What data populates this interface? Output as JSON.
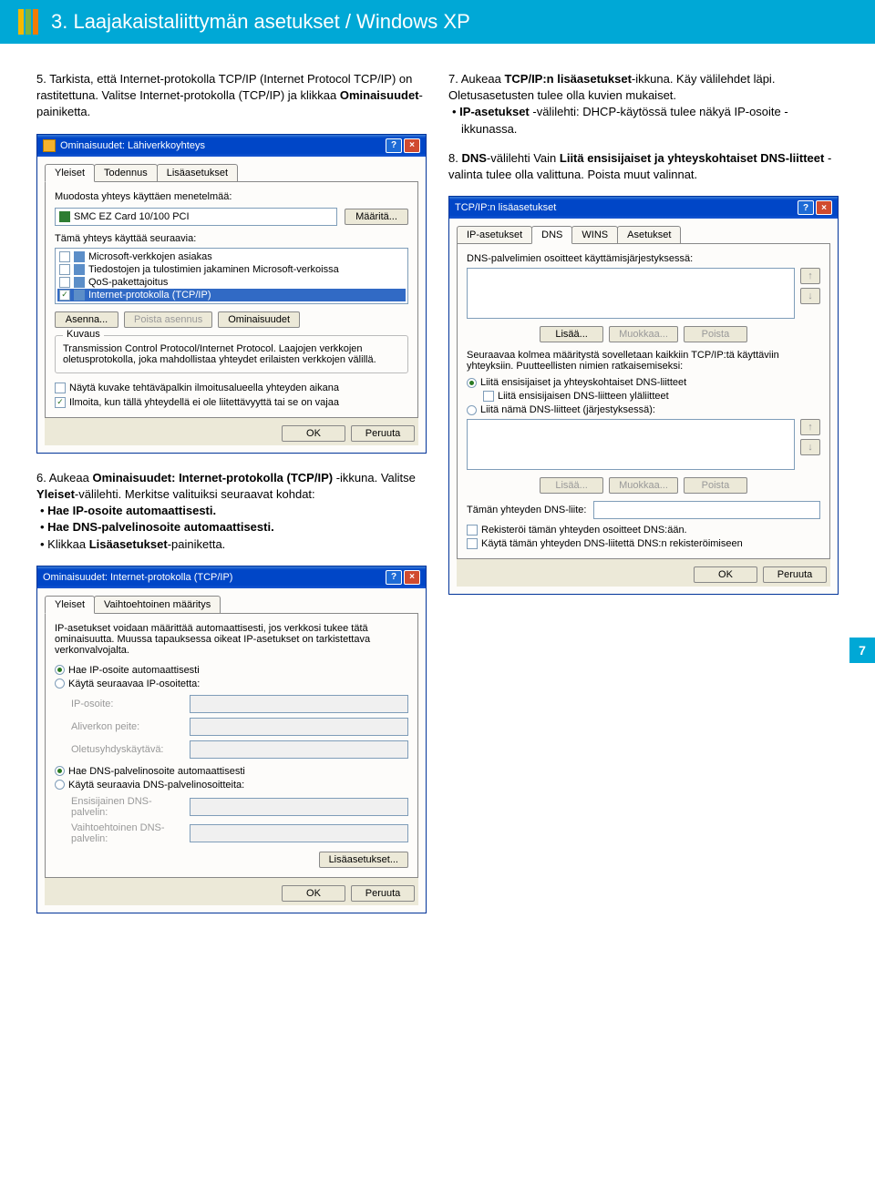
{
  "header": {
    "title": "3. Laajakaistaliittymän asetukset / Windows XP"
  },
  "page_number": "7",
  "steps": {
    "s5": {
      "num": "5.",
      "text": "Tarkista, että Internet-protokolla TCP/IP (Internet Protocol TCP/IP) on rastitettuna. Valitse Internet-protokolla (TCP/IP) ja klikkaa ",
      "bold": "Ominaisuudet",
      "tail": "-painiketta."
    },
    "s6": {
      "num": "6.",
      "text": "Aukeaa ",
      "b1": "Ominaisuudet: Internet-protokolla (TCP/IP)",
      "mid": " -ikkuna. Valitse ",
      "b2": "Yleiset",
      "mid2": "-välilehti. Merkitse valituiksi seuraavat kohdat:",
      "bul1": "Hae IP-osoite automaattisesti.",
      "bul2": "Hae DNS-palvelinosoite automaattisesti.",
      "bul3a": "Klikkaa ",
      "bul3b": "Lisäasetukset",
      "bul3c": "-painiketta."
    },
    "s7": {
      "num": "7.",
      "text": "Aukeaa ",
      "b1": "TCP/IP:n lisäasetukset",
      "mid": "-ikkuna. Käy välilehdet läpi. Oletusasetusten tulee olla kuvien mukaiset.",
      "bul1a": "IP-asetukset",
      "bul1b": " -välilehti: DHCP-käytössä tulee näkyä IP-osoite -ikkunassa."
    },
    "s8": {
      "num": "8.",
      "b1": "DNS",
      "mid": "-välilehti Vain ",
      "b2": "Liitä ensisijaiset ja yhteyskohtaiset DNS-liitteet",
      "tail": " -valinta tulee olla valittuna. Poista muut valinnat."
    }
  },
  "win1": {
    "title": "Ominaisuudet: Lähiverkkoyhteys",
    "tabs": [
      "Yleiset",
      "Todennus",
      "Lisäasetukset"
    ],
    "connect_using_label": "Muodosta yhteys käyttäen menetelmää:",
    "adapter": "SMC EZ Card 10/100 PCI",
    "configure_btn": "Määritä...",
    "uses_label": "Tämä yhteys käyttää seuraavia:",
    "items": [
      {
        "checked": false,
        "label": "Microsoft-verkkojen asiakas"
      },
      {
        "checked": false,
        "label": "Tiedostojen ja tulostimien jakaminen Microsoft-verkoissa"
      },
      {
        "checked": false,
        "label": "QoS-pakettajoitus"
      },
      {
        "checked": true,
        "label": "Internet-protokolla (TCP/IP)",
        "selected": true
      }
    ],
    "install_btn": "Asenna...",
    "uninstall_btn": "Poista asennus",
    "properties_btn": "Ominaisuudet",
    "desc_title": "Kuvaus",
    "desc_text": "Transmission Control Protocol/Internet Protocol. Laajojen verkkojen oletusprotokolla, joka mahdollistaa yhteydet erilaisten verkkojen välillä.",
    "cb_show_icon": "Näytä kuvake tehtäväpalkin ilmoitusalueella yhteyden aikana",
    "cb_notify": "Ilmoita, kun tällä yhteydellä ei ole liitettävyyttä tai se on vajaa",
    "ok": "OK",
    "cancel": "Peruuta"
  },
  "win2": {
    "title": "TCP/IP:n lisäasetukset",
    "tabs": [
      "IP-asetukset",
      "DNS",
      "WINS",
      "Asetukset"
    ],
    "dns_order_label": "DNS-palvelimien osoitteet käyttämisjärjestyksessä:",
    "up": "↑",
    "down": "↓",
    "add_btn": "Lisää...",
    "edit_btn": "Muokkaa...",
    "del_btn": "Poista",
    "three_text": "Seuraavaa kolmea määritystä sovelletaan kaikkiin TCP/IP:tä käyttäviin yhteyksiin. Puutteellisten nimien ratkaisemiseksi:",
    "r1": "Liitä ensisijaiset ja yhteyskohtaiset DNS-liitteet",
    "r1_sub": "Liitä ensisijaisen DNS-liitteen yläliitteet",
    "r2": "Liitä nämä DNS-liitteet (järjestyksessä):",
    "suffix_label": "Tämän yhteyden DNS-liite:",
    "cb_register": "Rekisteröi tämän yhteyden osoitteet DNS:ään.",
    "cb_use_suffix": "Käytä tämän yhteyden DNS-liitettä DNS:n rekisteröimiseen",
    "ok": "OK",
    "cancel": "Peruuta"
  },
  "win3": {
    "title": "Ominaisuudet: Internet-protokolla (TCP/IP)",
    "tabs": [
      "Yleiset",
      "Vaihtoehtoinen määritys"
    ],
    "intro": "IP-asetukset voidaan määrittää automaattisesti, jos verkkosi tukee tätä ominaisuutta. Muussa tapauksessa oikeat IP-asetukset on tarkistettava verkonvalvojalta.",
    "r_ip_auto": "Hae IP-osoite automaattisesti",
    "r_ip_manual": "Käytä seuraavaa IP-osoitetta:",
    "ip_label": "IP-osoite:",
    "mask_label": "Aliverkon peite:",
    "gw_label": "Oletusyhdyskäytävä:",
    "r_dns_auto": "Hae DNS-palvelinosoite automaattisesti",
    "r_dns_manual": "Käytä seuraavia DNS-palvelinosoitteita:",
    "dns1_label": "Ensisijainen DNS-palvelin:",
    "dns2_label": "Vaihtoehtoinen DNS-palvelin:",
    "adv_btn": "Lisäasetukset...",
    "ok": "OK",
    "cancel": "Peruuta"
  }
}
